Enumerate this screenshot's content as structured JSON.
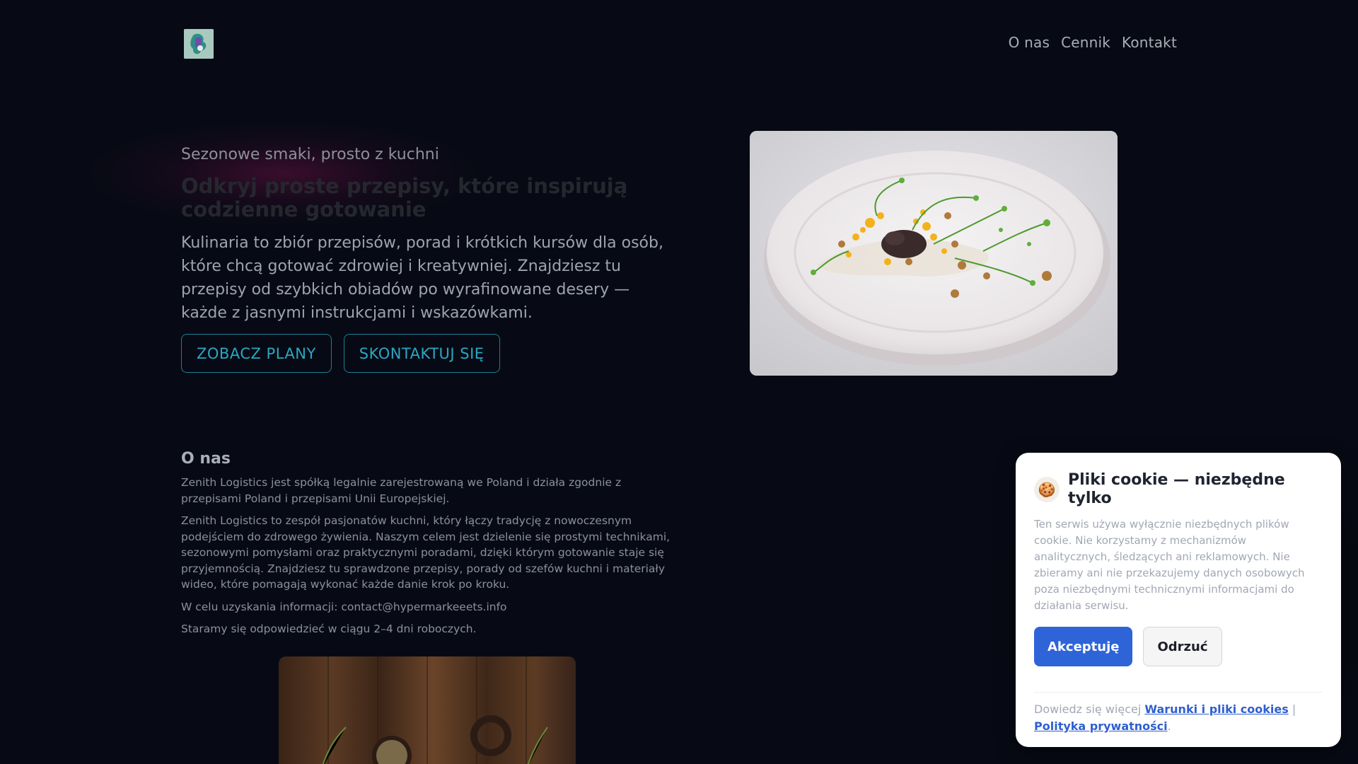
{
  "header": {
    "logo_alt": "logo",
    "nav": [
      {
        "label": "O nas"
      },
      {
        "label": "Cennik"
      },
      {
        "label": "Kontakt"
      }
    ]
  },
  "hero": {
    "tagline": "Sezonowe smaki, prosto z kuchni",
    "title": "Odkryj proste przepisy, które inspirują codzienne gotowanie",
    "text": "Kulinaria to zbiór przepisów, porad i krótkich kursów dla osób, które chcą gotować zdrowiej i kreatywniej. Znajdziesz tu przepisy od szybkich obiadów po wyrafinowane desery — każde z jasnymi instrukcjami i wskazówkami.",
    "primary_button": "ZOBACZ PLANY",
    "secondary_button": "SKONTAKTUJ SIĘ"
  },
  "about": {
    "title": "O nas",
    "paragraphs": [
      "Zenith Logistics jest spółką legalnie zarejestrowaną we Poland i działa zgodnie z przepisami Poland i przepisami Unii Europejskiej.",
      "Zenith Logistics to zespół pasjonatów kuchni, który łączy tradycję z nowoczesnym podejściem do zdrowego żywienia. Naszym celem jest dzielenie się prostymi technikami, sezonowymi pomysłami oraz praktycznymi poradami, dzięki którym gotowanie staje się przyjemnością. Znajdziesz tu sprawdzone przepisy, porady od szefów kuchni i materiały wideo, które pomagają wykonać każde danie krok po kroku.",
      "W celu uzyskania informacji: contact@hypermarkeeets.info",
      "Staramy się odpowiedzieć w ciągu 2–4 dni roboczych."
    ]
  },
  "cookie": {
    "icon": "cookie-icon",
    "icon_glyph": "🍪",
    "title": "Pliki cookie — niezbędne tylko",
    "text": "Ten serwis używa wyłącznie niezbędnych plików cookie. Nie korzystamy z mechanizmów analitycznych, śledzących ani reklamowych. Nie zbieramy ani nie przekazujemy danych osobowych poza niezbędnymi technicznymi informacjami do działania serwisu.",
    "accept": "Akceptuję",
    "reject": "Odrzuć",
    "more_prefix": "Dowiedz się więcej",
    "link_terms": "Warunki i pliki cookies",
    "separator": "|",
    "link_privacy": "Polityka prywatności",
    "suffix": "."
  },
  "colors": {
    "background": "#070a14",
    "accent_cyan": "#2aa7c2",
    "accept_blue": "#2f64d8"
  }
}
